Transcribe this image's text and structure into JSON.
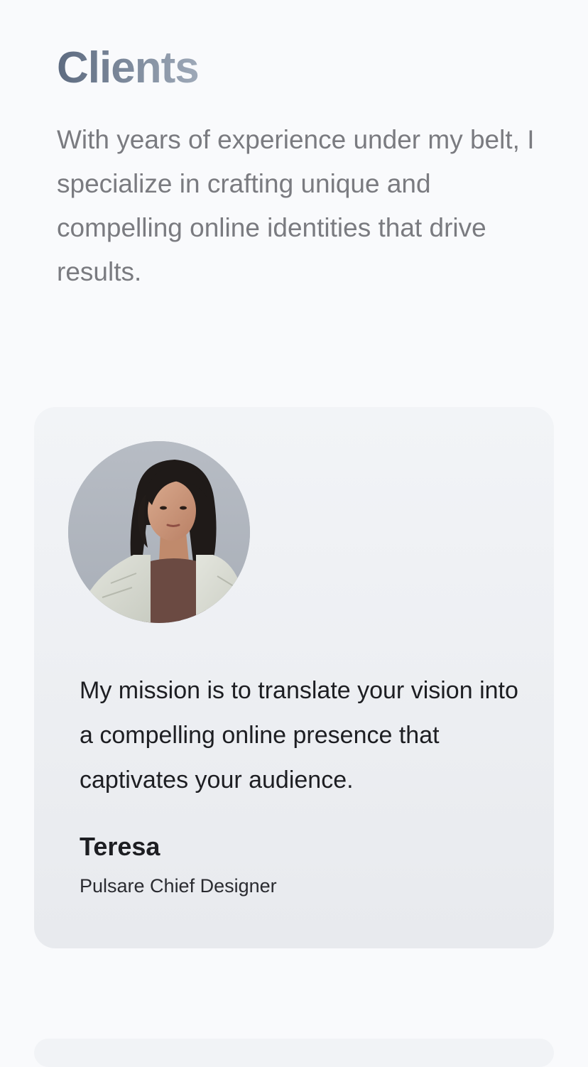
{
  "section": {
    "title": "Clients",
    "intro": "With years of experience under my belt, I specialize in crafting unique and compelling online identities that drive results."
  },
  "testimonial": {
    "avatar_alt": "Teresa portrait",
    "quote": "My mission is to translate your vision into a compelling online presence that captivates your audience.",
    "author_name": "Teresa",
    "author_role": "Pulsare Chief Designer"
  },
  "colors": {
    "page_background": "#f9fafc",
    "title_gradient_start": "#5d6b80",
    "title_gradient_end": "#9ea9b8",
    "body_text": "#7a7b80",
    "card_text": "#1d1e22"
  }
}
